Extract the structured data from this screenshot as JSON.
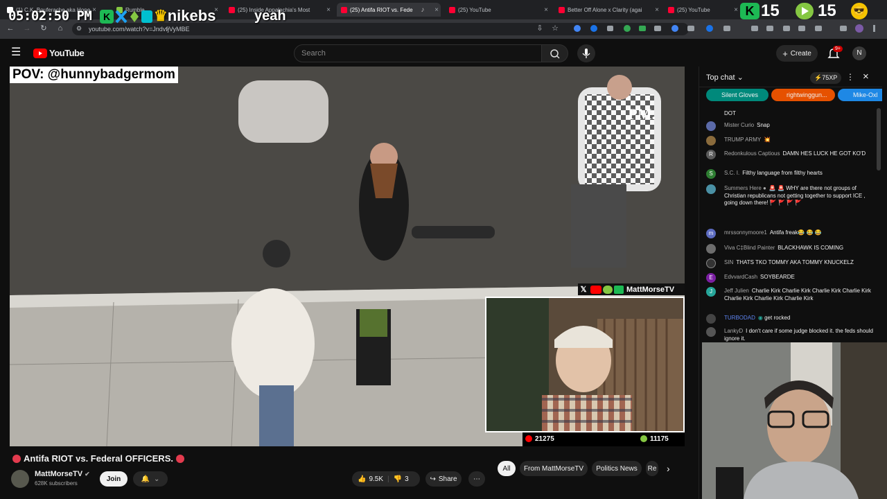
{
  "overlay": {
    "clock": "05:02:50 PM",
    "name": "nikebs",
    "yeah": "yeah"
  },
  "tabs": [
    {
      "title": "(1) C.K. Bouferache aka Hone",
      "color": "#ffffff"
    },
    {
      "title": "Rumble",
      "color": "#85c742"
    },
    {
      "title": "(25) Inside Appalachia's Most",
      "color": "#ff0033"
    },
    {
      "title": "(25) Antifa RIOT vs. Fede",
      "color": "#ff0033"
    },
    {
      "title": "(25) YouTube",
      "color": "#ff0033"
    },
    {
      "title": "Better Off Alone x Clarity (agai",
      "color": "#ff0033"
    },
    {
      "title": "(25) YouTube",
      "color": "#ff0033"
    }
  ],
  "stream_counters": {
    "left": "15",
    "right": "15"
  },
  "browser": {
    "url": "youtube.com/watch?v=Jndvf̷jVyMBE"
  },
  "youtube": {
    "logo": "YouTube",
    "search_placeholder": "Search",
    "create_label": "Create",
    "notif_count": "9+"
  },
  "video": {
    "pov_label": "POV: @hunnybadgermom",
    "watermark": "PM.",
    "cam_tag": "MattMorseTV",
    "youtube_viewers": "21275",
    "rumble_viewers": "11175"
  },
  "meta": {
    "title": "Antifa RIOT vs. Federal OFFICERS.",
    "channel": "MattMorseTV",
    "subscribers": "628K subscribers",
    "join": "Join",
    "likes": "9.5K",
    "dislikes": "3",
    "share": "Share"
  },
  "chips": [
    "All",
    "From MattMorseTV",
    "Politics News",
    "Re"
  ],
  "chat": {
    "mode": "Top chat",
    "xp": "75XP",
    "gifters": [
      "Silent Gloves",
      "rightwinggun...",
      "Mike-Oxl"
    ],
    "messages": [
      {
        "author": "",
        "text": "DOT",
        "avatar": "",
        "color": "#555"
      },
      {
        "author": "Mister Curio",
        "text": "Snap",
        "avatar": "",
        "color": "#5b6aa8"
      },
      {
        "author": "TRUMP ARMY",
        "text": "💥",
        "avatar": "",
        "color": "#8a6b3c"
      },
      {
        "author": "Redonkulous Captious",
        "text": "DAMN HES LUCK HE GOT KO'D",
        "avatar": "R",
        "color": "#5a5a5a"
      },
      {
        "author": "S.C. I.",
        "text": "Filthy language from filthy hearts",
        "avatar": "S",
        "color": "#2e7d32"
      },
      {
        "author": "Summers Here ●",
        "text": "🚨 🚨 WHY are there not groups of Christian republicans not getting together to support ICE , going down there! 🚩 🚩 🚩 🚩",
        "avatar": "",
        "color": "#4a90a4"
      },
      {
        "author": "mrssonnymoore1",
        "text": "Antifa freak😂 😂 😂",
        "avatar": "m",
        "color": "#5c6bc0"
      },
      {
        "author": "Viva C‡Blind Painter",
        "text": "BLACKHAWK IS COMING",
        "avatar": "",
        "color": "#6d6d6d"
      },
      {
        "author": "SIN",
        "text": "THATS TKO TOMMY AKA TOMMY KNUCKELZ",
        "avatar": "",
        "color": "#333"
      },
      {
        "author": "EdvvardCash",
        "text": "SOYBEARDE",
        "avatar": "E",
        "color": "#7b1fa2"
      },
      {
        "author": "Jeff Julien",
        "text": "Charlie Kirk Charlie Kirk Charlie Kirk Charlie Kirk Charlie Kirk Charlie Kirk Charlie Kirk",
        "avatar": "J",
        "color": "#26a69a"
      },
      {
        "author": "TURBODAD",
        "text": "get rocked",
        "avatar": "",
        "color": "#444"
      },
      {
        "author": "LankyD",
        "text": "I don't care if some judge blocked it. the feds should ignore it.",
        "avatar": "",
        "color": "#555"
      }
    ]
  }
}
